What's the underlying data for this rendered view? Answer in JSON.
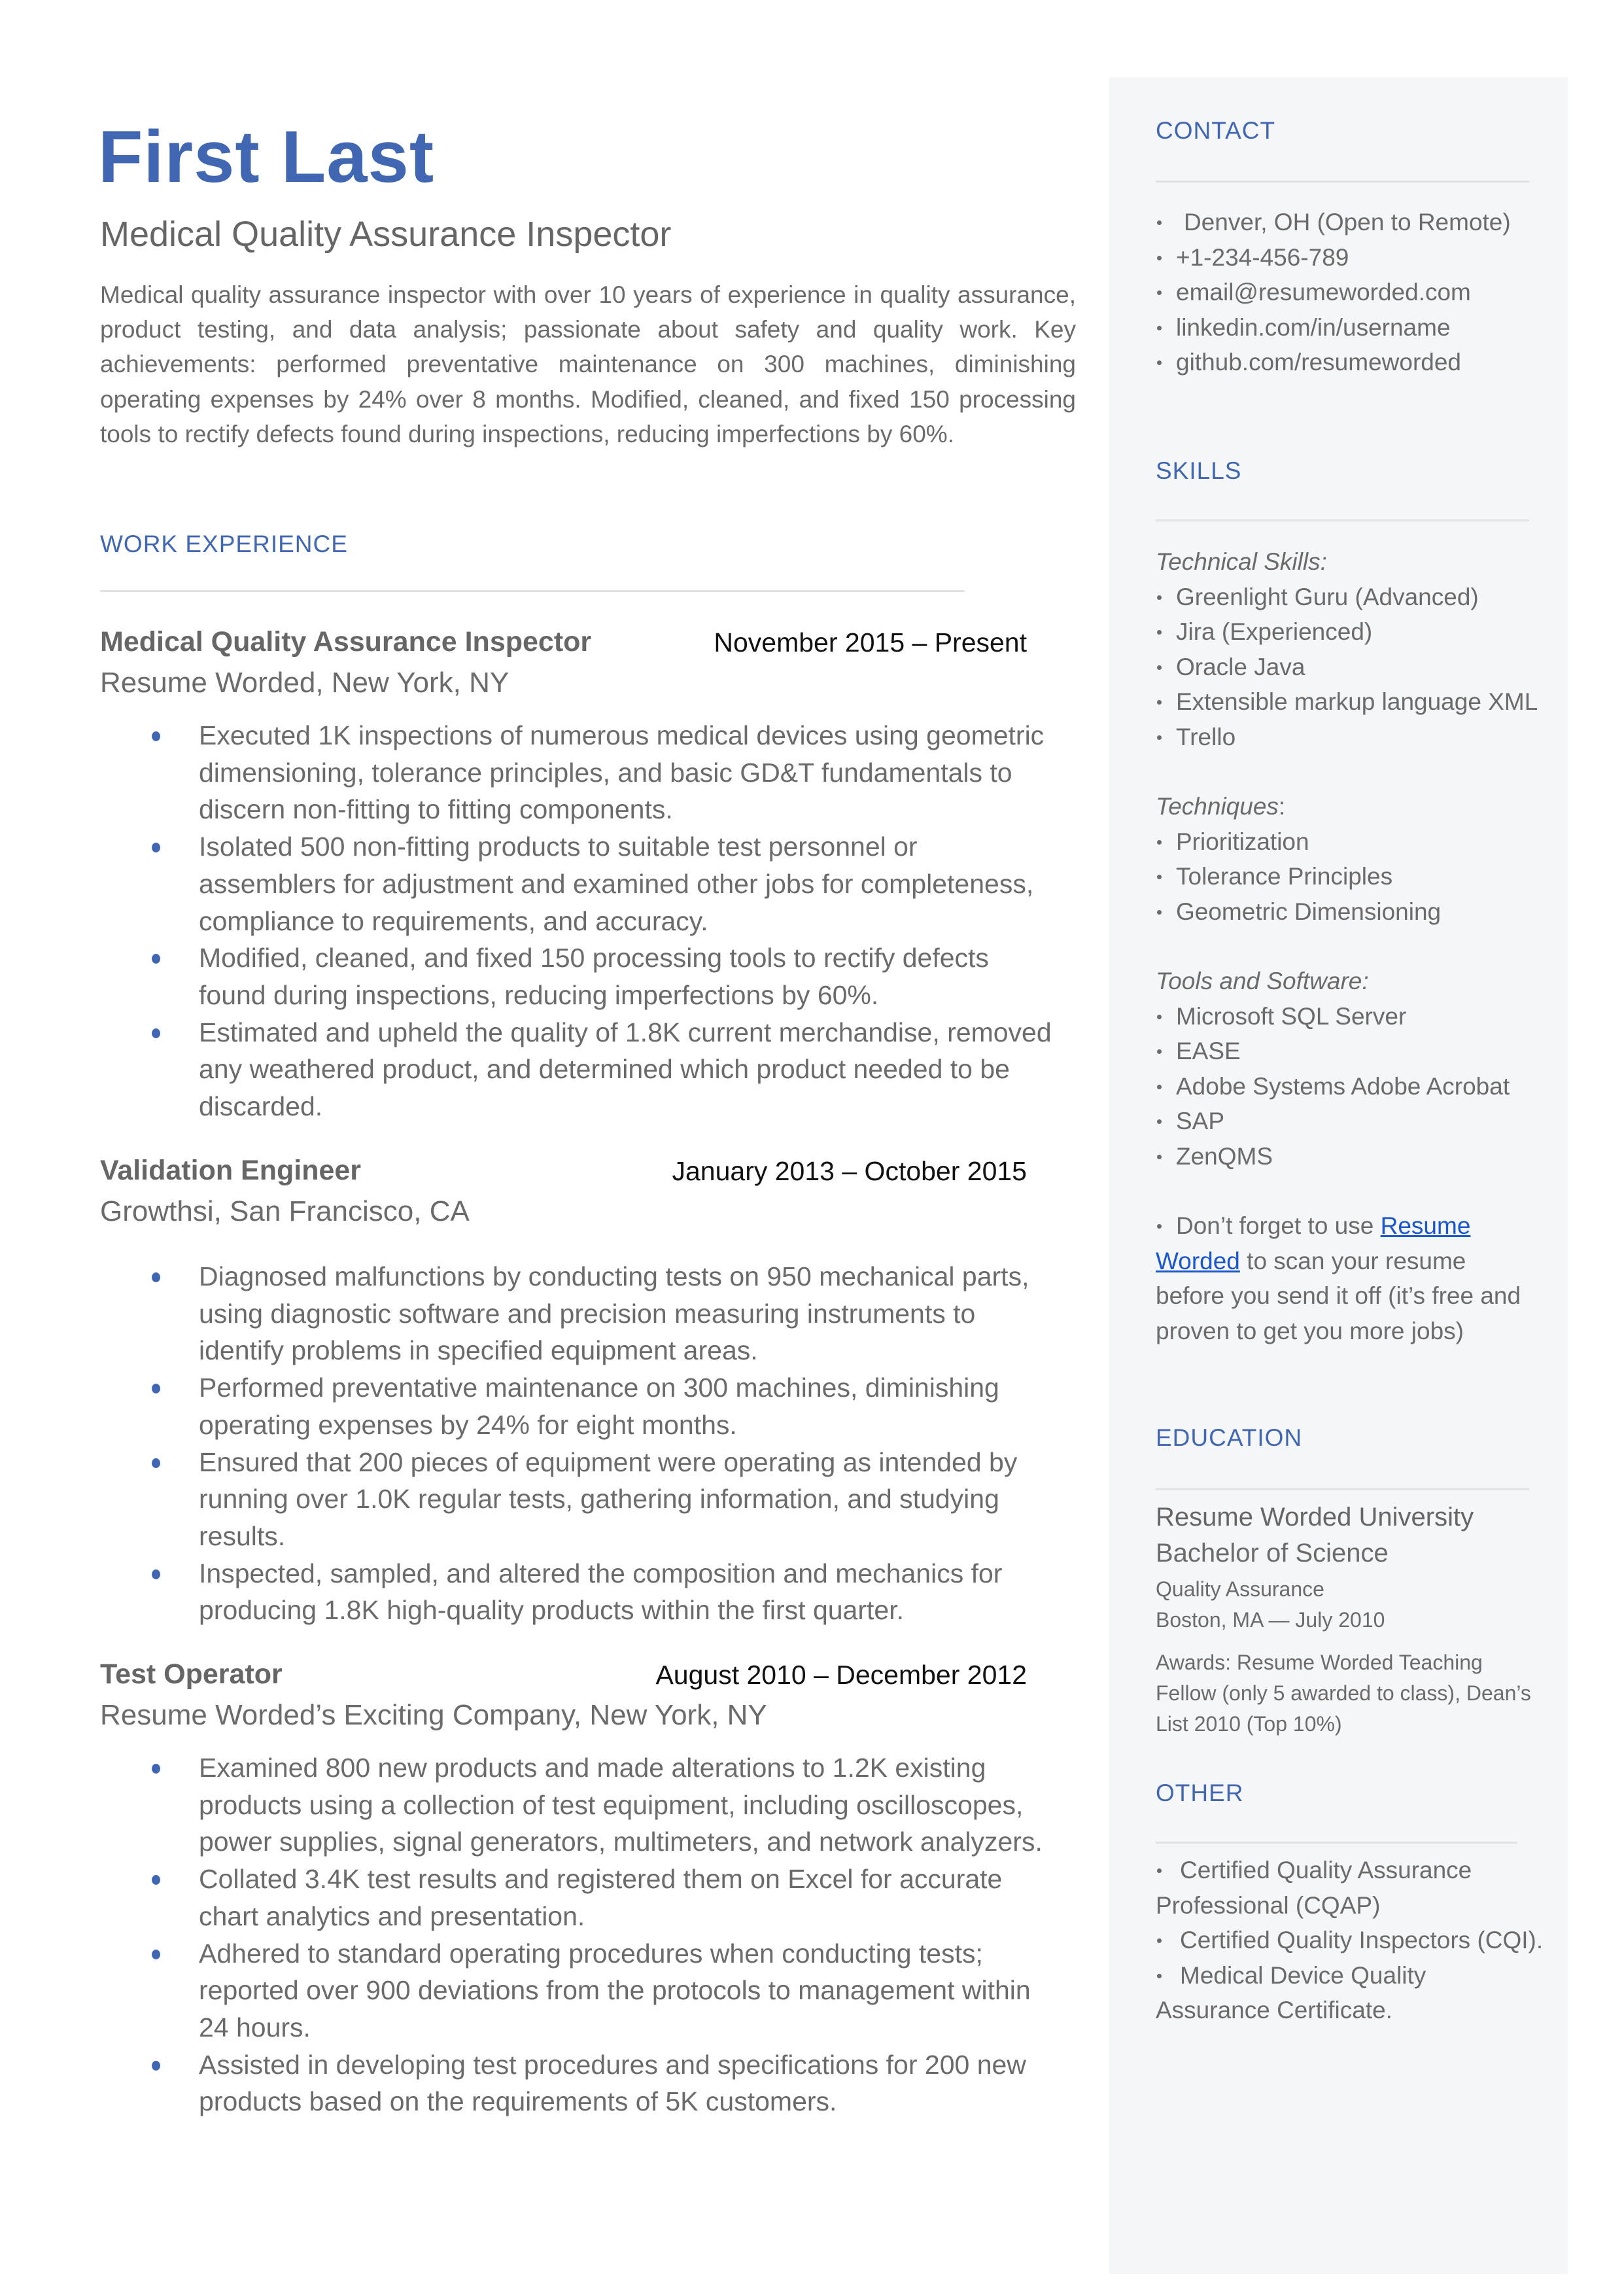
{
  "header": {
    "name": "First Last",
    "title": "Medical Quality Assurance Inspector",
    "summary": "Medical quality assurance inspector with over 10 years of experience in quality assurance, product testing, and data analysis; passionate about safety and quality work. Key achievements: performed preventative maintenance on 300 machines, diminishing operating expenses by 24% over 8 months. Modified, cleaned, and fixed 150 processing tools to rectify defects found during inspections, reducing imperfections by 60%."
  },
  "colors": {
    "accent": "#4267b2",
    "body_text": "#6b6b6b",
    "sidebar_bg": "#f5f6f8",
    "link": "#1a56cc"
  },
  "work": {
    "heading": "WORK EXPERIENCE",
    "jobs": [
      {
        "title": "Medical Quality Assurance Inspector",
        "dates": "November 2015 – Present",
        "company": "Resume Worded, New York, NY",
        "bullets": [
          "Executed 1K inspections of numerous medical devices using geometric dimensioning, tolerance principles, and basic GD&T fundamentals to discern non-fitting to fitting components.",
          "Isolated 500 non-fitting products to suitable test personnel or assemblers for adjustment and examined other jobs for completeness, compliance to requirements, and accuracy.",
          "Modified, cleaned, and fixed 150 processing tools to rectify defects found during inspections, reducing imperfections by 60%.",
          "Estimated and upheld the quality of 1.8K current merchandise, removed any weathered product, and determined which product needed to be discarded."
        ]
      },
      {
        "title": "Validation Engineer",
        "dates": "January 2013 – October 2015",
        "company": "Growthsi, San Francisco, CA",
        "bullets": [
          "Diagnosed malfunctions by conducting tests on 950 mechanical parts, using diagnostic software and precision measuring instruments to identify problems in specified equipment areas.",
          "Performed preventative maintenance on 300 machines, diminishing operating expenses by 24% for eight months.",
          "Ensured that 200 pieces of equipment were operating as intended by running over 1.0K regular tests, gathering information, and studying results.",
          "Inspected, sampled, and altered the composition and mechanics for producing 1.8K high-quality products within the first quarter."
        ]
      },
      {
        "title": "Test Operator",
        "dates": "August 2010 – December 2012",
        "company": "Resume Worded’s Exciting Company, New York, NY",
        "bullets": [
          "Examined 800 new products and made alterations to 1.2K existing products using a collection of test equipment, including oscilloscopes, power supplies, signal generators, multimeters, and network analyzers.",
          "Collated 3.4K test results and registered them on Excel for accurate chart analytics and presentation.",
          "Adhered to standard operating procedures when conducting tests; reported over 900 deviations from the protocols to management within 24 hours.",
          "Assisted in developing test procedures and specifications for 200 new products based on the requirements of 5K customers."
        ]
      }
    ]
  },
  "sidebar": {
    "contact": {
      "heading": "CONTACT",
      "items": [
        "Denver, OH (Open to Remote)",
        "+1-234-456-789",
        "email@resumeworded.com",
        "linkedin.com/in/username",
        "github.com/resumeworded"
      ]
    },
    "skills": {
      "heading": "SKILLS",
      "categories": [
        {
          "label": "Technical Skills:",
          "items": [
            "Greenlight Guru (Advanced)",
            "Jira (Experienced)",
            "Oracle Java",
            "Extensible markup language XML",
            "Trello"
          ]
        },
        {
          "label": "Techniques",
          "label_suffix": ":",
          "items": [
            "Prioritization",
            "Tolerance Principles",
            "Geometric Dimensioning"
          ]
        },
        {
          "label": "Tools and Software:",
          "items": [
            "Microsoft SQL Server",
            "EASE",
            "Adobe Systems Adobe Acrobat",
            "SAP",
            "ZenQMS"
          ]
        }
      ],
      "tip": {
        "prefix": "Don’t forget to use ",
        "link_text_1": "Resume",
        "link_text_2": "Worded",
        "suffix_1": " to scan your resume",
        "line_3": "before you send it off (it’s free and",
        "line_4": "proven to get you more jobs)"
      }
    },
    "education": {
      "heading": "EDUCATION",
      "school": "Resume Worded University",
      "degree": "Bachelor of Science",
      "field": "Quality Assurance",
      "location_date": "Boston, MA — July 2010",
      "awards_lines": [
        "Awards: Resume Worded Teaching",
        "Fellow (only 5 awarded to class), Dean’s",
        "List 2010 (Top 10%)"
      ]
    },
    "other": {
      "heading": "OTHER",
      "lines": [
        {
          "bullet": true,
          "text": "Certified Quality Assurance"
        },
        {
          "bullet": false,
          "text": "Professional (CQAP)"
        },
        {
          "bullet": true,
          "text": "Certified Quality Inspectors (CQI)."
        },
        {
          "bullet": true,
          "text": "Medical Device Quality"
        },
        {
          "bullet": false,
          "text": "Assurance Certificate."
        }
      ]
    }
  }
}
